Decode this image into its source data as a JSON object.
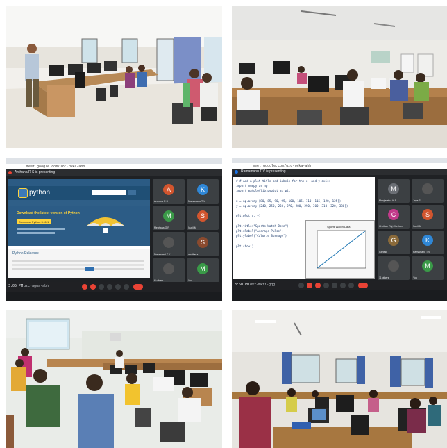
{
  "meet_left": {
    "url": "meet.google.com/uzc-rwka-ahb",
    "presenting": "Archana R S is presenting",
    "site_logo": "python",
    "headline": "Download the latest version of Python",
    "download_button": "Download Python 3.11.1",
    "section_title": "Python Releases",
    "taskbar_time": "3:05 PM",
    "meeting_code": "uzc-agua-abh",
    "tiles": [
      {
        "initial": "A",
        "name": "Archana R S",
        "color": "#d2552e"
      },
      {
        "initial": "K",
        "name": "Ramamanu T V",
        "color": "#2f87d6"
      },
      {
        "initial": "M",
        "name": "Meghana G R",
        "color": "#3a9a48"
      },
      {
        "initial": "S",
        "name": "Sunil M",
        "color": "#d2552e"
      },
      {
        "initial": "",
        "name": "Ramamani T V",
        "color": "#555"
      },
      {
        "initial": "S",
        "name": "sarittha s",
        "color": "#8a4a2e"
      },
      {
        "initial": "",
        "name": "H others",
        "color": "#555"
      },
      {
        "initial": "M",
        "name": "You",
        "color": "#3a9a48"
      }
    ]
  },
  "meet_right": {
    "url": "meet.google.com/uzc-rwka-ahb",
    "presenting": "Ramamanu T V is presenting",
    "code_lines": [
      "# # Add a plot title and labels for the x- and y-axis:",
      "import numpy as np",
      "import matplotlib.pyplot as plt",
      "",
      "x = np.array([80, 85, 90, 95, 100, 105, 110, 115, 120, 125])",
      "y = np.array([240, 250, 260, 270, 280, 290, 300, 310, 320, 330])",
      "",
      "plt.plot(x, y)",
      "",
      "plt.title(\"Sports Watch Data\")",
      "plt.xlabel(\"Average Pulse\")",
      "plt.ylabel(\"Calorie Burnage\")",
      "",
      "plt.show()"
    ],
    "plot_title": "Sports Watch Data",
    "taskbar_time": "3:50 PM",
    "meeting_code": "dvz-mkti-gqg",
    "tiles": [
      {
        "initial": "M",
        "name": "Manjunatha K S",
        "color": "#6b6f75"
      },
      {
        "initial": "",
        "name": "Jaya S",
        "color": "#555"
      },
      {
        "initial": "C",
        "name": "Chethan Raj Chethan",
        "color": "#c23a8a"
      },
      {
        "initial": "S",
        "name": "Sunil M",
        "color": "#d2552e"
      },
      {
        "initial": "G",
        "name": "Ganesh",
        "color": "#8a6a3a"
      },
      {
        "initial": "K",
        "name": "Ramamanu T V",
        "color": "#2f87d6"
      },
      {
        "initial": "",
        "name": "11 others",
        "color": "#555"
      },
      {
        "initial": "M",
        "name": "You",
        "color": "#3a9a48"
      }
    ],
    "accent": "#1a73e8"
  }
}
